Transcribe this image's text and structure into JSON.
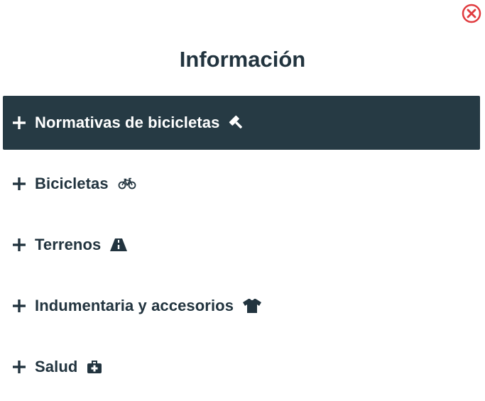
{
  "page": {
    "title": "Información"
  },
  "colors": {
    "active_bg": "#263a44",
    "text": "#22343f",
    "close": "#e03a3e"
  },
  "accordion": {
    "items": [
      {
        "label": "Normativas de bicicletas",
        "icon": "gavel-icon",
        "state": "active"
      },
      {
        "label": "Bicicletas",
        "icon": "bicycle-icon",
        "state": "collapsed"
      },
      {
        "label": "Terrenos",
        "icon": "road-icon",
        "state": "collapsed"
      },
      {
        "label": "Indumentaria y accesorios",
        "icon": "tshirt-icon",
        "state": "collapsed"
      },
      {
        "label": "Salud",
        "icon": "medkit-icon",
        "state": "collapsed"
      }
    ]
  }
}
